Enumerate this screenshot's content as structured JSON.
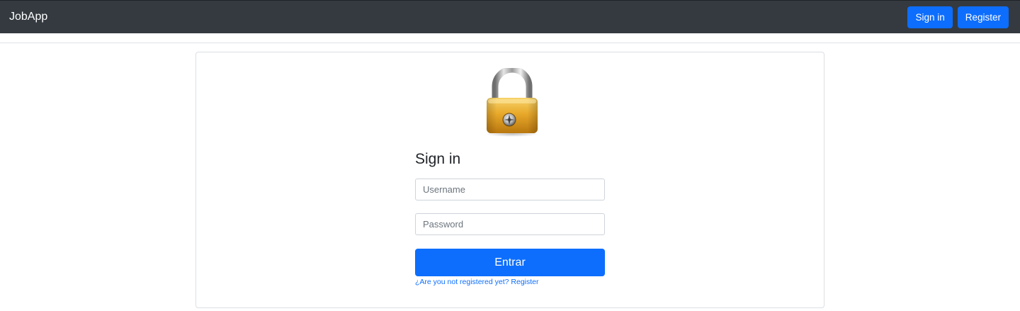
{
  "navbar": {
    "brand": "JobApp",
    "signin_label": "Sign in",
    "register_label": "Register"
  },
  "login": {
    "icon": "lock-icon",
    "title": "Sign in",
    "username_placeholder": "Username",
    "username_value": "",
    "password_placeholder": "Password",
    "password_value": "",
    "submit_label": "Entrar",
    "register_link": "¿Are you not registered yet? Register"
  },
  "colors": {
    "navbar_bg": "#343a40",
    "primary": "#0d6efd",
    "lock_gold": "#e8a92a"
  }
}
